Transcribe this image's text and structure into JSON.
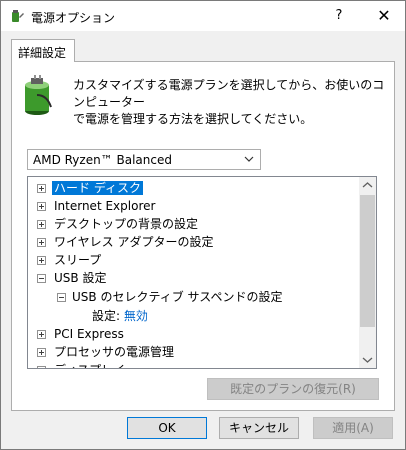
{
  "window": {
    "title": "電源オプション",
    "help_label": "?",
    "close_label": "✕"
  },
  "tab": {
    "label": "詳細設定"
  },
  "description": {
    "line1": "カスタマイズする電源プランを選択してから、お使いのコンピューター",
    "line2": "で電源を管理する方法を選択してください。"
  },
  "plan_select": {
    "value": "AMD Ryzen™ Balanced"
  },
  "tree": {
    "items": [
      {
        "label": "ハード ディスク",
        "state": "collapsed"
      },
      {
        "label": "Internet Explorer",
        "state": "collapsed"
      },
      {
        "label": "デスクトップの背景の設定",
        "state": "collapsed"
      },
      {
        "label": "ワイヤレス アダプターの設定",
        "state": "collapsed"
      },
      {
        "label": "スリープ",
        "state": "collapsed"
      },
      {
        "label": "USB 設定",
        "state": "expanded"
      },
      {
        "label": "USB のセレクティブ サスペンドの設定",
        "state": "expanded"
      },
      {
        "label": "設定:",
        "value": "無効"
      },
      {
        "label": "PCI Express",
        "state": "collapsed"
      },
      {
        "label": "プロセッサの電源管理",
        "state": "collapsed"
      },
      {
        "label": "ディスプレイ",
        "state": "collapsed"
      }
    ]
  },
  "restore_button": {
    "label": "既定のプランの復元(R)"
  },
  "buttons": {
    "ok": "OK",
    "cancel": "キャンセル",
    "apply": "適用(A)"
  },
  "colors": {
    "selection": "#0078d7",
    "link": "#0066cc"
  }
}
